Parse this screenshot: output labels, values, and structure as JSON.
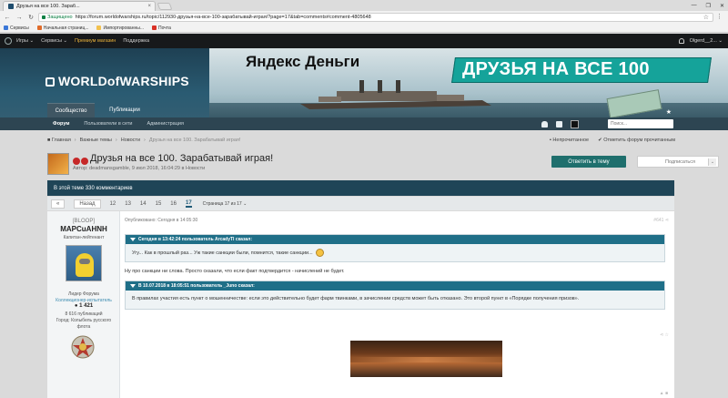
{
  "browser": {
    "tab_title": "Друзья на все 100. Зараб...",
    "tab_close": "×",
    "window_controls": [
      "—",
      "❐",
      "✕"
    ],
    "secure_label": "Защищено",
    "url": "https://forum.worldofwarships.ru/topic/112930-друзья-на-все-100-зарабатывай-играя/?page=17&tab=comments#comment-4805648",
    "bookmarks": [
      {
        "label": "Сервисы",
        "color": "#3b78d8"
      },
      {
        "label": "Начальная страниц...",
        "color": "#e06b2a"
      },
      {
        "label": "Импортированны...",
        "color": "#f2c14e"
      },
      {
        "label": "Почта",
        "color": "#d93025"
      }
    ],
    "star_icon": "☆",
    "menu_icon": "⋮"
  },
  "sitebar": {
    "items": [
      {
        "label": "Игры ⌄"
      },
      {
        "label": "Сервисы ⌄"
      },
      {
        "label": "Премиум магазин"
      },
      {
        "label": "Поддержка"
      }
    ],
    "user": "Olgerd__2... ⌄"
  },
  "banner": {
    "logo": "WORLDofWARSHIPS",
    "yandex": "Яндекс Деньги",
    "slogan": "ДРУЗЬЯ НА ВСЕ 100",
    "tabs": [
      {
        "label": "Сообщество"
      },
      {
        "label": "Публикации"
      }
    ],
    "fav": "★"
  },
  "subnav": {
    "items": [
      {
        "label": "Форум"
      },
      {
        "label": "Пользователи в сети"
      },
      {
        "label": "Администрация"
      }
    ],
    "search_placeholder": "Поиск..."
  },
  "breadcrumb": {
    "items": [
      "Главная",
      "Важные темы",
      "Новости",
      "Друзья на все 100. Зарабатывай играя!"
    ],
    "sep": "›",
    "right": [
      "Непрочитанное",
      "Отметить форум прочитанным"
    ]
  },
  "topic": {
    "title": "Друзья на все 100. Зарабатывай играя!",
    "meta": "Автор: deadmansgamble, 9 июл 2018, 16:04:29 в Новости",
    "reply_label": "Ответить в тему",
    "follow_label": "Подписаться",
    "follow_count": "⌄"
  },
  "comments_bar": "В этой теме 330 комментариев",
  "pager": {
    "first": "«",
    "prev": "Назад",
    "pages": [
      "12",
      "13",
      "14",
      "15",
      "16",
      "17"
    ],
    "current": "17",
    "select": "Страница 17 из 17 ⌄"
  },
  "author": {
    "clan": "[BLOOP]",
    "name": "MAPCuAHNH",
    "rank": "Капитан-лейтенант",
    "group": "Лидер Форума",
    "group2": "Коллекционер-испытатель",
    "rep": "● 1 421",
    "posts": "8 616 публикаций",
    "city": "Город: Колыбель русского флота"
  },
  "post": {
    "posted": "Опубликовано: Сегодня в 14:05:30",
    "tools": "#641 ⋖",
    "quote1_head": "Сегодня в 13:42:24 пользователь ArcadyTI сказал:",
    "quote1_text": "Угу... Как в прошлый раз... Уж такие санкции были, помнится, такие санкции...",
    "text1": "Ну про санкции ни слова. Просто сказали, что если факт подтвердится - начислений не будет.",
    "quote2_head": "В 10.07.2018 в 18:05:51 пользователь _Juno сказал:",
    "quote2_text": "В правилах участия есть пункт о мошенничестве: если это действительно будет фарм твинками, в зачислении средств может быть отказано. Это второй пункт в «Порядке получения призов».",
    "share": "⋖ ☆",
    "bottom": "▲ ■"
  },
  "colors": {
    "accent": "#1f6f6d",
    "header_dark": "#17191b",
    "nav": "#2d4552",
    "premium": "#e9b23b",
    "quote_head": "#1f6f88"
  }
}
